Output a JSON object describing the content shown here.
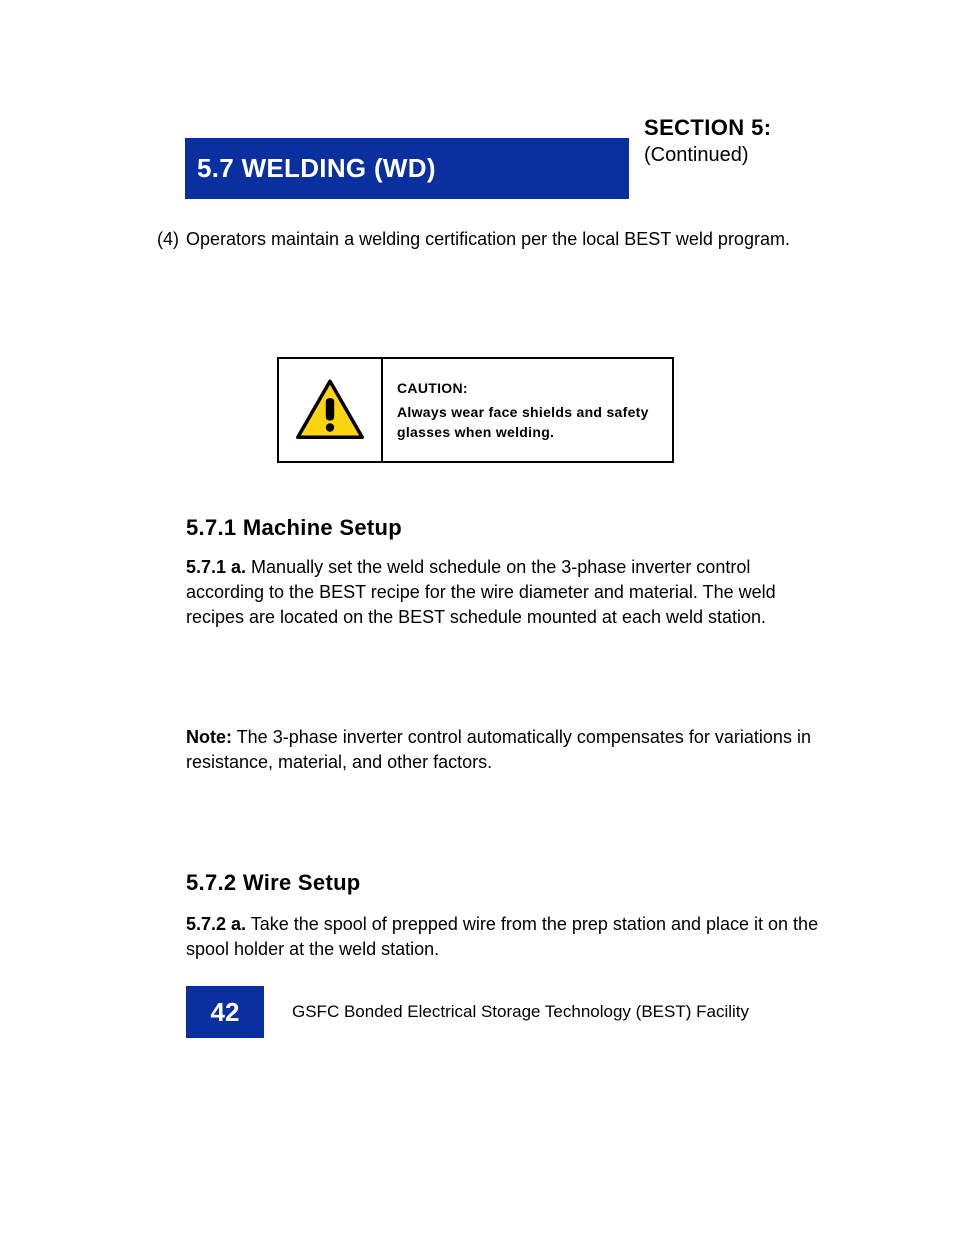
{
  "section_bar_title": "5.7  WELDING (WD)",
  "section_caption": "SECTION 5:",
  "section_sub": "(Continued)",
  "intro_hang": "(4)",
  "intro_text": "Operators maintain a welding certification per the local BEST weld program.",
  "caution": {
    "label": "CAUTION:",
    "text": "Always wear face shields and safety glasses when welding."
  },
  "heading_a": "5.7.1  Machine Setup",
  "paragraph_a_runin": "5.7.1 a.",
  "paragraph_a": "  Manually set the weld schedule on the 3-phase inverter control according to the BEST recipe for the wire diameter and material. The weld recipes are located on the BEST schedule mounted at each weld station.",
  "note_label": "Note:",
  "note_text": "  The 3-phase inverter control automatically compensates for variations in resistance, material, and other factors.",
  "heading_b": "5.7.2  Wire Setup",
  "paragraph_b_runin": "5.7.2 a.",
  "paragraph_b": "  Take the spool of prepped wire from the prep station and place it on the spool holder at the weld station.",
  "footer": {
    "page_number": "42",
    "text": "GSFC Bonded Electrical Storage Technology (BEST) Facility"
  }
}
